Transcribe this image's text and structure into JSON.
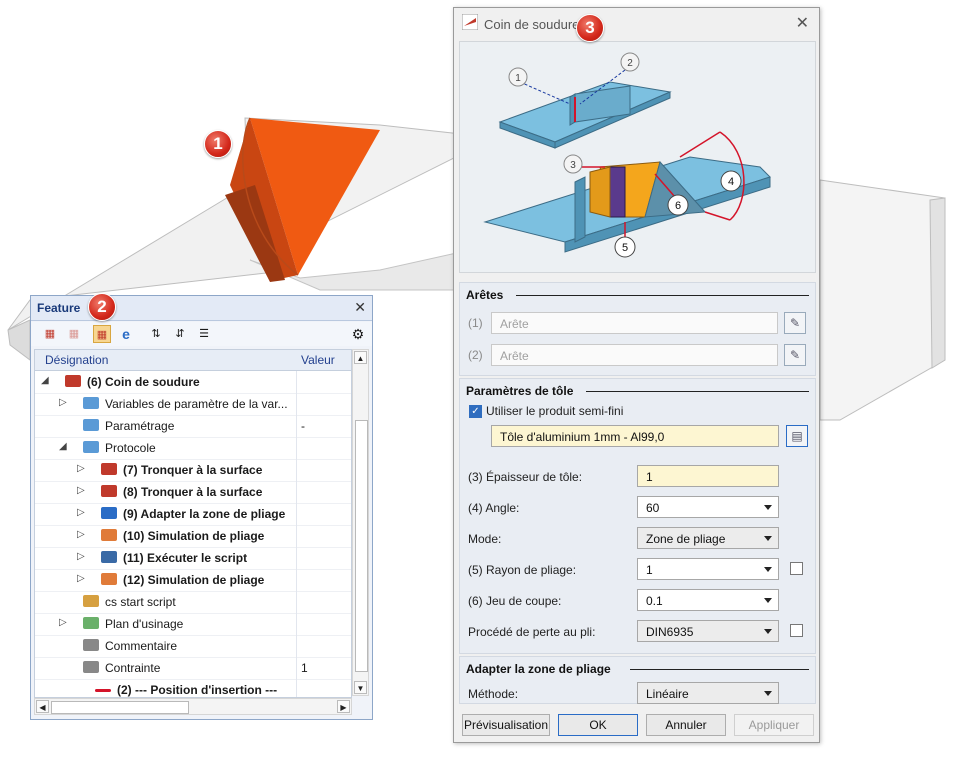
{
  "badges": {
    "one": "1",
    "two": "2",
    "three": "3"
  },
  "feature_panel": {
    "title": "Feature",
    "close_glyph": "✕",
    "columns": {
      "designation": "Désignation",
      "value": "Valeur"
    },
    "rows": [
      {
        "label": "(6) Coin de soudure",
        "value": "",
        "bold": true,
        "expander": "◢"
      },
      {
        "label": "Variables de paramètre de la var...",
        "value": "",
        "bold": false,
        "expander": "▷"
      },
      {
        "label": "Paramétrage",
        "value": "-",
        "bold": false,
        "expander": ""
      },
      {
        "label": "Protocole",
        "value": "",
        "bold": false,
        "expander": "◢"
      },
      {
        "label": "(7) Tronquer à la surface",
        "value": "",
        "bold": true,
        "expander": "▷"
      },
      {
        "label": "(8) Tronquer à la surface",
        "value": "",
        "bold": true,
        "expander": "▷"
      },
      {
        "label": "(9) Adapter la zone de pliage",
        "value": "",
        "bold": true,
        "expander": "▷"
      },
      {
        "label": "(10) Simulation de pliage",
        "value": "",
        "bold": true,
        "expander": "▷"
      },
      {
        "label": "(11) Exécuter le script",
        "value": "",
        "bold": true,
        "expander": "▷"
      },
      {
        "label": "(12) Simulation de pliage",
        "value": "",
        "bold": true,
        "expander": "▷"
      },
      {
        "label": "cs start script",
        "value": "",
        "bold": false,
        "expander": ""
      },
      {
        "label": "Plan d'usinage",
        "value": "",
        "bold": false,
        "expander": "▷"
      },
      {
        "label": "Commentaire",
        "value": "",
        "bold": false,
        "expander": ""
      },
      {
        "label": "Contrainte",
        "value": "1",
        "bold": false,
        "expander": ""
      },
      {
        "label": "(2) --- Position  d'insertion ---",
        "value": "",
        "bold": true,
        "expander": ""
      }
    ]
  },
  "dialog": {
    "title": "Coin de soudure",
    "close_glyph": "✕",
    "diagram_callouts": [
      "1",
      "2",
      "3",
      "4",
      "5",
      "6"
    ],
    "aretes": {
      "header": "Arêtes",
      "edge1_label": "(1)",
      "edge1_placeholder": "Arête",
      "edge2_label": "(2)",
      "edge2_placeholder": "Arête"
    },
    "tole": {
      "header": "Paramètres de tôle",
      "use_semi_label": "Utiliser le produit semi-fini",
      "use_semi_checked": true,
      "semi_product": "Tôle d'aluminium 1mm - Al99,0",
      "thickness_label": "(3) Épaisseur de tôle:",
      "thickness_value": "1",
      "angle_label": "(4) Angle:",
      "angle_value": "60",
      "mode_label": "Mode:",
      "mode_value": "Zone de pliage",
      "radius_label": "(5) Rayon de pliage:",
      "radius_value": "1",
      "gap_label": "(6) Jeu de coupe:",
      "gap_value": "0.1",
      "loss_label": "Procédé de perte au pli:",
      "loss_value": "DIN6935"
    },
    "zone": {
      "header": "Adapter la zone de pliage",
      "method_label": "Méthode:",
      "method_value": "Linéaire"
    },
    "buttons": {
      "preview": "Prévisualisation",
      "ok": "OK",
      "cancel": "Annuler",
      "apply": "Appliquer"
    }
  },
  "colors": {
    "orange": "#f05a12",
    "plate_blue": "#6fb4d6",
    "accent_blue": "#2a6cc6",
    "badge_red": "#d3271a"
  }
}
